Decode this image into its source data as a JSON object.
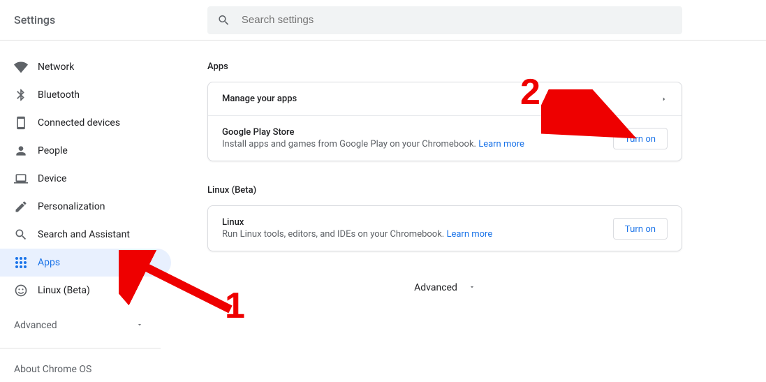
{
  "header": {
    "title": "Settings",
    "search_placeholder": "Search settings"
  },
  "sidebar": {
    "items": [
      {
        "label": "Network"
      },
      {
        "label": "Bluetooth"
      },
      {
        "label": "Connected devices"
      },
      {
        "label": "People"
      },
      {
        "label": "Device"
      },
      {
        "label": "Personalization"
      },
      {
        "label": "Search and Assistant"
      },
      {
        "label": "Apps"
      },
      {
        "label": "Linux (Beta)"
      }
    ],
    "advanced": "Advanced",
    "about": "About Chrome OS"
  },
  "main": {
    "apps_section": "Apps",
    "manage_apps": "Manage your apps",
    "play_title": "Google Play Store",
    "play_sub": "Install apps and games from Google Play on your Chromebook. ",
    "learn_more": "Learn more",
    "turn_on": "Turn on",
    "linux_section": "Linux (Beta)",
    "linux_title": "Linux",
    "linux_sub": "Run Linux tools, editors, and IDEs on your Chromebook. ",
    "advanced": "Advanced"
  },
  "annotations": {
    "one": "1",
    "two": "2"
  }
}
